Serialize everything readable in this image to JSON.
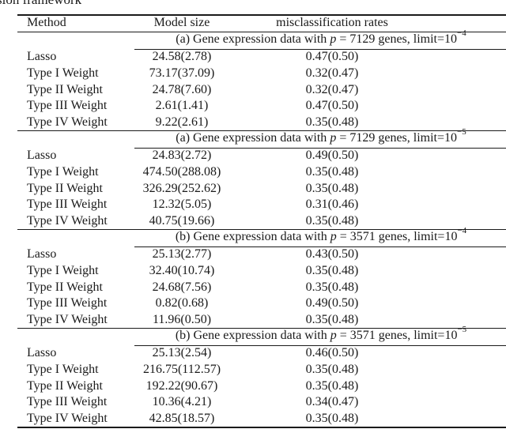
{
  "caption_fragment": "sion framework",
  "table": {
    "headers": {
      "method": "Method",
      "model_size": "Model size",
      "misclassification": "misclassification rates"
    },
    "sections": [
      {
        "label_prefix": "(a) Gene expression data with ",
        "p_symbol": "p",
        "label_mid": " = 7129 genes, limit=10",
        "exponent": "−4",
        "rows": [
          {
            "method": "Lasso",
            "model_size": "24.58(2.78)",
            "misclassification": "0.47(0.50)"
          },
          {
            "method": "Type I Weight",
            "model_size": "73.17(37.09)",
            "misclassification": "0.32(0.47)"
          },
          {
            "method": "Type II Weight",
            "model_size": "24.78(7.60)",
            "misclassification": "0.32(0.47)"
          },
          {
            "method": "Type III Weight",
            "model_size": "2.61(1.41)",
            "misclassification": "0.47(0.50)"
          },
          {
            "method": "Type IV Weight",
            "model_size": "9.22(2.61)",
            "misclassification": "0.35(0.48)"
          }
        ]
      },
      {
        "label_prefix": "(a) Gene expression data with ",
        "p_symbol": "p",
        "label_mid": " = 7129 genes, limit=10",
        "exponent": "−5",
        "rows": [
          {
            "method": "Lasso",
            "model_size": "24.83(2.72)",
            "misclassification": "0.49(0.50)"
          },
          {
            "method": "Type I Weight",
            "model_size": "474.50(288.08)",
            "misclassification": "0.35(0.48)"
          },
          {
            "method": "Type II Weight",
            "model_size": "326.29(252.62)",
            "misclassification": "0.35(0.48)"
          },
          {
            "method": "Type III Weight",
            "model_size": "12.32(5.05)",
            "misclassification": "0.31(0.46)"
          },
          {
            "method": "Type IV Weight",
            "model_size": "40.75(19.66)",
            "misclassification": "0.35(0.48)"
          }
        ]
      },
      {
        "label_prefix": "(b) Gene expression data with ",
        "p_symbol": "p",
        "label_mid": " = 3571 genes, limit=10",
        "exponent": "−4",
        "rows": [
          {
            "method": "Lasso",
            "model_size": "25.13(2.77)",
            "misclassification": "0.43(0.50)"
          },
          {
            "method": "Type I Weight",
            "model_size": "32.40(10.74)",
            "misclassification": "0.35(0.48)"
          },
          {
            "method": "Type II Weight",
            "model_size": "24.68(7.56)",
            "misclassification": "0.35(0.48)"
          },
          {
            "method": "Type III Weight",
            "model_size": "0.82(0.68)",
            "misclassification": "0.49(0.50)"
          },
          {
            "method": "Type IV Weight",
            "model_size": "11.96(0.50)",
            "misclassification": "0.35(0.48)"
          }
        ]
      },
      {
        "label_prefix": "(b) Gene expression data with ",
        "p_symbol": "p",
        "label_mid": " = 3571 genes, limit=10",
        "exponent": "−5",
        "rows": [
          {
            "method": "Lasso",
            "model_size": "25.13(2.54)",
            "misclassification": "0.46(0.50)"
          },
          {
            "method": "Type I Weight",
            "model_size": "216.75(112.57)",
            "misclassification": "0.35(0.48)"
          },
          {
            "method": "Type II Weight",
            "model_size": "192.22(90.67)",
            "misclassification": "0.35(0.48)"
          },
          {
            "method": "Type III Weight",
            "model_size": "10.36(4.21)",
            "misclassification": "0.34(0.47)"
          },
          {
            "method": "Type IV Weight",
            "model_size": "42.85(18.57)",
            "misclassification": "0.35(0.48)"
          }
        ]
      }
    ]
  }
}
